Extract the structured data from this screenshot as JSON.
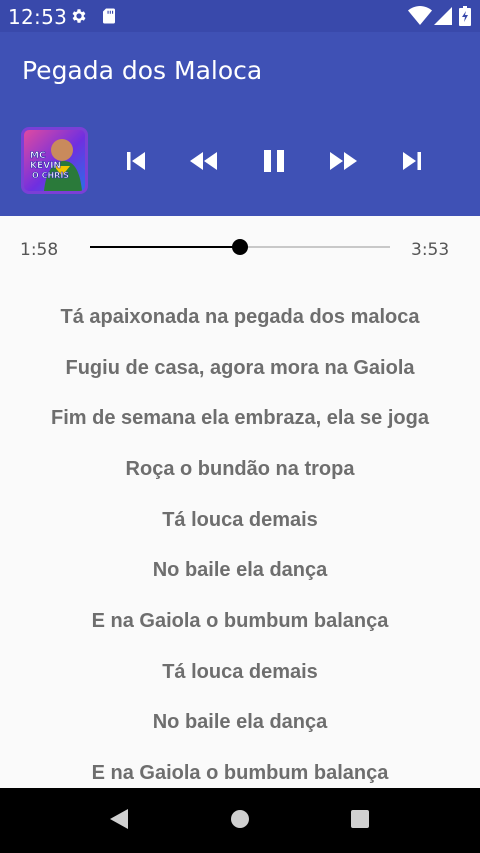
{
  "status_bar": {
    "time": "12:53",
    "icons_left": [
      "gear-icon",
      "sd-card-icon"
    ],
    "icons_right": [
      "wifi-icon",
      "cell-signal-icon",
      "battery-charging-icon"
    ]
  },
  "app_bar": {
    "title": "Pegada dos Maloca"
  },
  "player": {
    "album_art_text": [
      "MC",
      "KEVIN",
      "O CHRIS"
    ],
    "controls": [
      "skip-previous-icon",
      "rewind-icon",
      "pause-icon",
      "fast-forward-icon",
      "skip-next-icon"
    ],
    "accent_color": "#3f51b5"
  },
  "progress": {
    "current": "1:58",
    "total": "3:53",
    "fraction": 0.5
  },
  "lyrics": [
    "Tá apaixonada na pegada dos maloca",
    "Fugiu de casa, agora mora na Gaiola",
    "Fim de semana ela embraza, ela se joga",
    "Roça o bundão na tropa",
    "Tá louca demais",
    "No baile ela dança",
    "E na Gaiola o bumbum balança",
    "Tá louca demais",
    "No baile ela dança",
    "E na Gaiola o bumbum balança"
  ],
  "nav_bar": {
    "icons": [
      "back-icon",
      "home-icon",
      "recents-icon"
    ]
  }
}
